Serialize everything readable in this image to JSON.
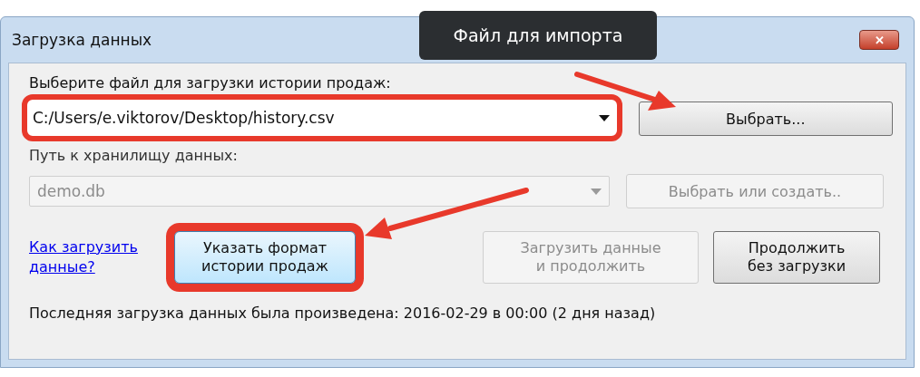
{
  "window": {
    "title": "Загрузка данных",
    "close_label": "✕"
  },
  "tooltip": {
    "text": "Файл для импорта"
  },
  "source": {
    "label": "Выберите файл для загрузки истории продаж:",
    "value": "C:/Users/e.viktorov/Desktop/history.csv",
    "disabled": false,
    "highlighted": true,
    "button": {
      "label": "Выбрать...",
      "disabled": false
    }
  },
  "storage": {
    "label": "Путь к хранилищу данных:",
    "value": "demo.db",
    "disabled": true,
    "highlighted": false,
    "button": {
      "label": "Выбрать или создать..",
      "disabled": true
    }
  },
  "help_link": "Как загрузить данные?",
  "actions": [
    {
      "label": "Указать формат истории продаж",
      "disabled": false,
      "highlighted": true,
      "focused": true
    },
    {
      "label": "Загрузить данные и продолжить",
      "disabled": true,
      "highlighted": false,
      "focused": false
    },
    {
      "label": "Продолжить без загрузки",
      "disabled": false,
      "highlighted": false,
      "focused": false
    }
  ],
  "status": "Последняя загрузка данных была произведена: 2016-02-29 в 00:00 (2 дня назад)"
}
